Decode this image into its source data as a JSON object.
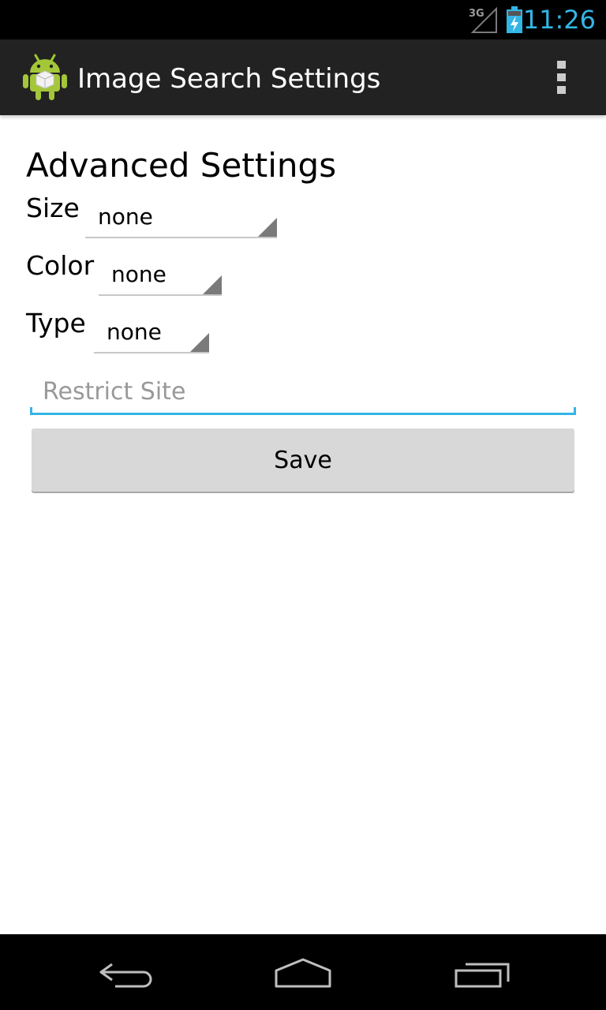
{
  "status_bar": {
    "network": "3G",
    "time": "11:26",
    "accent_color": "#33b5e5"
  },
  "action_bar": {
    "title": "Image Search Settings",
    "app_icon": "android-icon",
    "overflow_icon": "overflow-menu-icon"
  },
  "form": {
    "heading": "Advanced Settings",
    "size": {
      "label": "Size",
      "value": "none"
    },
    "color": {
      "label": "Color",
      "value": "none"
    },
    "type": {
      "label": "Type",
      "value": "none"
    },
    "site": {
      "placeholder": "Restrict Site",
      "value": ""
    },
    "save_label": "Save"
  },
  "nav_bar": {
    "back_icon": "back-icon",
    "home_icon": "home-icon",
    "recents_icon": "recent-apps-icon"
  }
}
